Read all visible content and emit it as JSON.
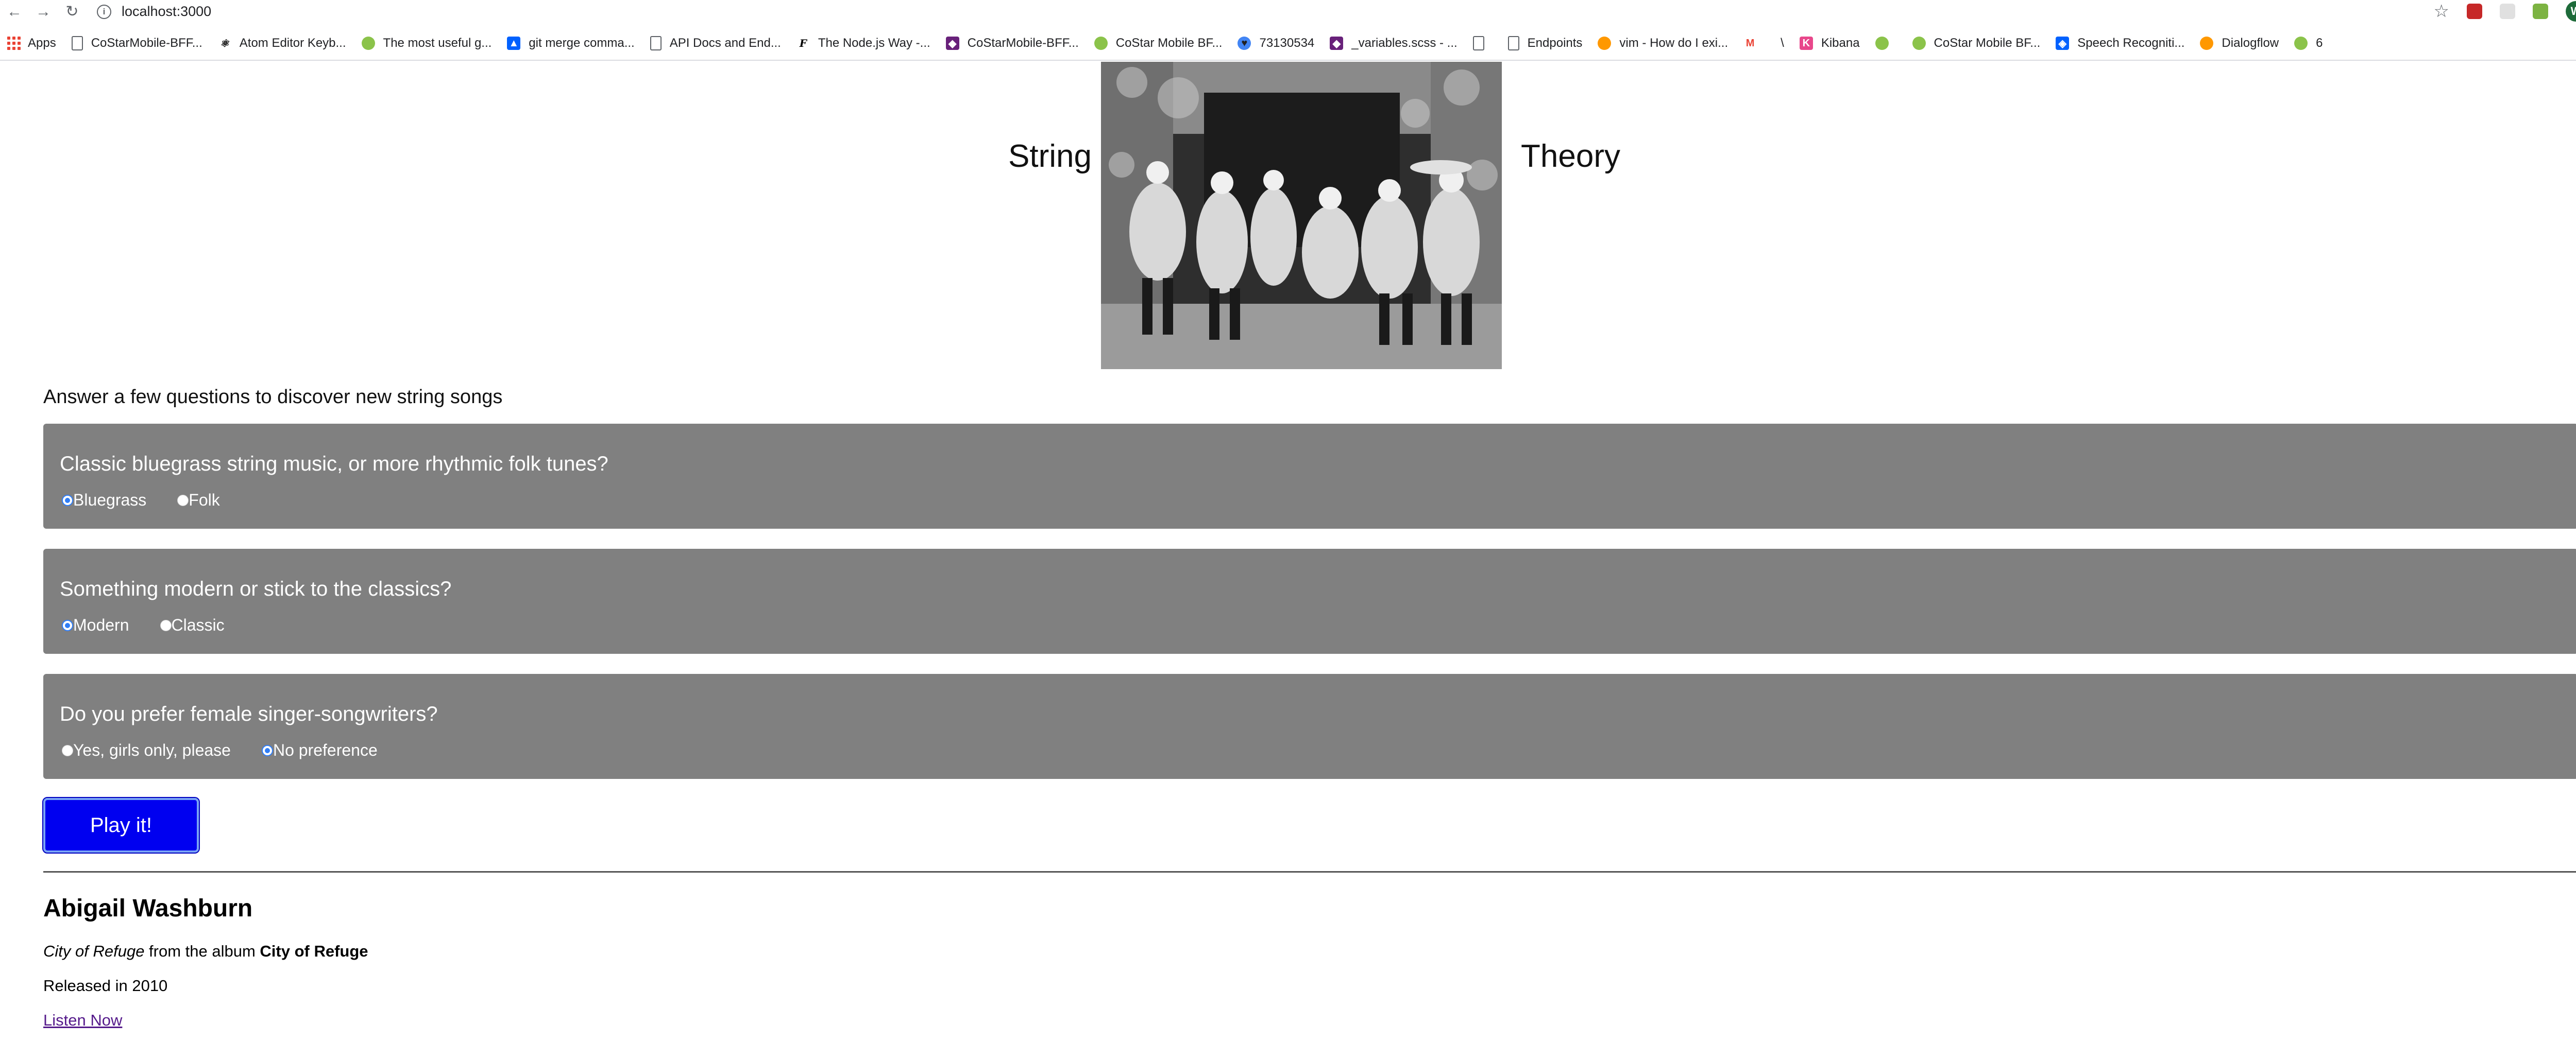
{
  "browser": {
    "url": "localhost:3000",
    "avatar_letter": "W",
    "bookmarks": [
      {
        "label": "Apps",
        "icon": "apps-grid-icon"
      },
      {
        "label": "CoStarMobile-BFF...",
        "icon": "document-icon"
      },
      {
        "label": "Atom Editor Keyb...",
        "icon": "atom-icon"
      },
      {
        "label": "The most useful g...",
        "icon": "green-blob-icon"
      },
      {
        "label": "git merge comma...",
        "icon": "atlassian-icon"
      },
      {
        "label": "API Docs and End...",
        "icon": "document-icon"
      },
      {
        "label": "The Node.js Way -...",
        "icon": "f-logo-icon"
      },
      {
        "label": "CoStarMobile-BFF...",
        "icon": "visual-studio-icon"
      },
      {
        "label": "CoStar Mobile BF...",
        "icon": "green-circle-icon"
      },
      {
        "label": "73130534",
        "icon": "heart-icon"
      },
      {
        "label": "_variables.scss - ...",
        "icon": "visual-studio-icon"
      },
      {
        "label": "",
        "icon": "document-icon"
      },
      {
        "label": "Endpoints",
        "icon": "document-icon"
      },
      {
        "label": "vim - How do I exi...",
        "icon": "stack-overflow-icon"
      },
      {
        "label": "",
        "icon": "gmail-icon"
      },
      {
        "label": "\\",
        "icon": ""
      },
      {
        "label": "Kibana",
        "icon": "kibana-icon"
      },
      {
        "label": "",
        "icon": "green-circle-icon"
      },
      {
        "label": "CoStar Mobile BF...",
        "icon": "green-circle-icon"
      },
      {
        "label": "Speech Recogniti...",
        "icon": "dropbox-icon"
      },
      {
        "label": "Dialogflow",
        "icon": "dialogflow-icon"
      },
      {
        "label": "6",
        "icon": "green-circle-icon"
      }
    ]
  },
  "header": {
    "title_left": "String",
    "title_right": "Theory"
  },
  "intro": "Answer a few questions to discover new string songs",
  "questions": [
    {
      "text": "Classic bluegrass string music, or more rhythmic folk tunes?",
      "options": [
        {
          "label": "Bluegrass",
          "checked": true
        },
        {
          "label": "Folk",
          "checked": false
        }
      ]
    },
    {
      "text": "Something modern or stick to the classics?",
      "options": [
        {
          "label": "Modern",
          "checked": true
        },
        {
          "label": "Classic",
          "checked": false
        }
      ]
    },
    {
      "text": "Do you prefer female singer-songwriters?",
      "options": [
        {
          "label": "Yes, girls only, please",
          "checked": false
        },
        {
          "label": "No preference",
          "checked": true
        }
      ]
    }
  ],
  "play_button": "Play it!",
  "result": {
    "artist": "Abigail Washburn",
    "song": "City of Refuge",
    "from_text": " from the album ",
    "album": "City of Refuge",
    "released": "Released in 2010",
    "listen_link": "Listen Now"
  },
  "colors": {
    "card_bg": "#808080",
    "button_bg": "#0000f0",
    "radio_checked": "#2f7df6"
  }
}
